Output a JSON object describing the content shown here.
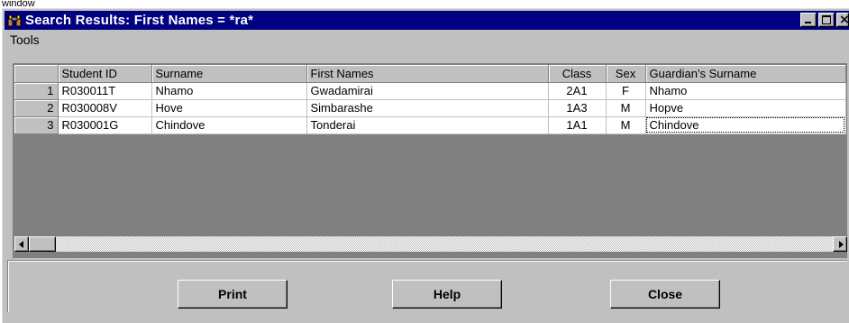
{
  "window": {
    "title": "Search Results: First Names = *ra*",
    "behind_caption": "window"
  },
  "menu": {
    "items": [
      {
        "label": "Tools"
      }
    ]
  },
  "grid": {
    "columns": [
      "",
      "Student ID",
      "Surname",
      "First Names",
      "Class",
      "Sex",
      "Guardian's Surname"
    ],
    "rows": [
      {
        "num": "1",
        "student_id": "R030011T",
        "surname": "Nhamo",
        "first_names": "Gwadamirai",
        "class": "2A1",
        "sex": "F",
        "guardian_surname": "Nhamo"
      },
      {
        "num": "2",
        "student_id": "R030008V",
        "surname": "Hove",
        "first_names": "Simbarashe",
        "class": "1A3",
        "sex": "M",
        "guardian_surname": "Hopve"
      },
      {
        "num": "3",
        "student_id": "R030001G",
        "surname": "Chindove",
        "first_names": "Tonderai",
        "class": "1A1",
        "sex": "M",
        "guardian_surname": "Chindove"
      }
    ]
  },
  "buttons": {
    "print": "Print",
    "help": "Help",
    "close": "Close"
  },
  "colors": {
    "titlebar": "#000080",
    "face": "#c0c0c0",
    "empty_grid": "#808080"
  },
  "icons": {
    "app": "binoculars-icon",
    "minimize": "minimize-icon",
    "maximize": "maximize-icon",
    "close": "close-icon"
  }
}
